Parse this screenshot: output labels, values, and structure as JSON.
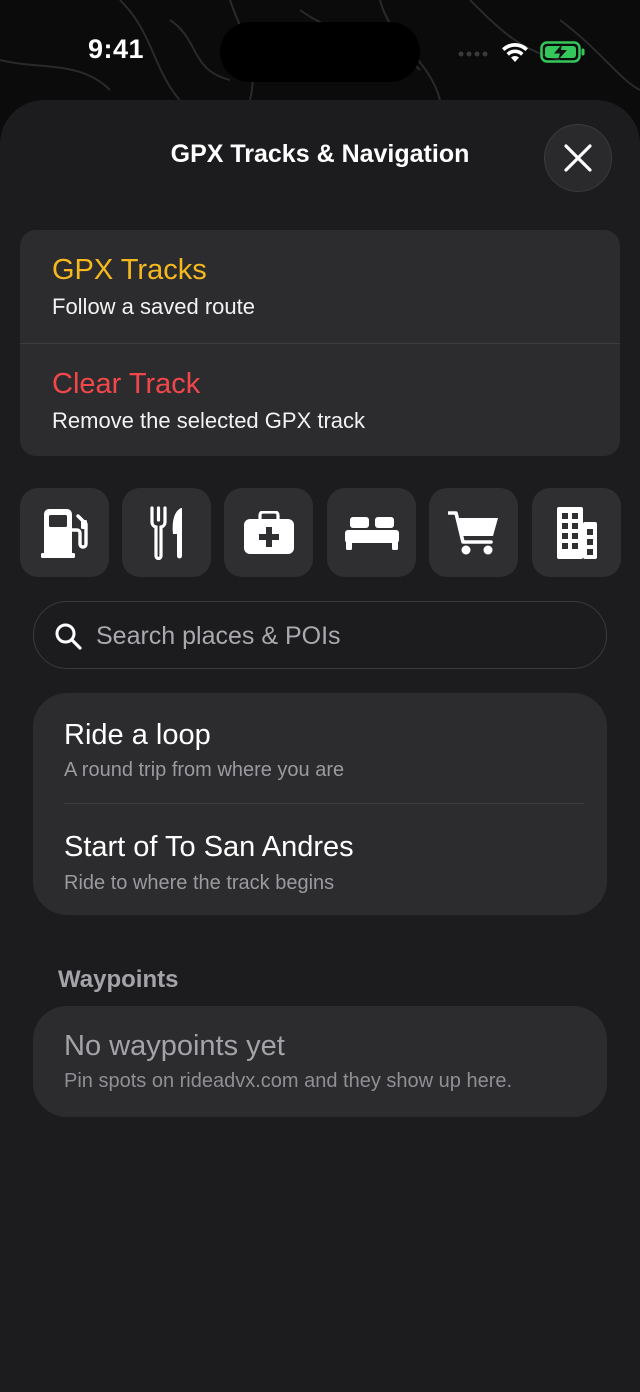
{
  "status_bar": {
    "time": "9:41",
    "icons": [
      "wifi-icon",
      "battery-charging-icon"
    ],
    "battery_color": "#34c759"
  },
  "sheet": {
    "title": "GPX Tracks & Navigation",
    "close_icon": "close-icon"
  },
  "tracks": {
    "items": [
      {
        "title": "GPX Tracks",
        "subtitle": "Follow a saved route",
        "color": "#f5b81f"
      },
      {
        "title": "Clear Track",
        "subtitle": "Remove the selected GPX track",
        "color": "#f2474a"
      }
    ]
  },
  "poi_categories": [
    {
      "icon": "fuel-pump-icon"
    },
    {
      "icon": "fork-knife-icon"
    },
    {
      "icon": "medical-kit-icon"
    },
    {
      "icon": "bed-icon"
    },
    {
      "icon": "shopping-cart-icon"
    },
    {
      "icon": "building-icon"
    }
  ],
  "search": {
    "placeholder": "Search places & POIs",
    "icon": "search-icon"
  },
  "navigation": {
    "items": [
      {
        "title": "Ride a loop",
        "subtitle": "A round trip from where you are"
      },
      {
        "title": "Start of To San Andres",
        "subtitle": "Ride to where the track begins"
      }
    ]
  },
  "waypoints": {
    "header": "Waypoints",
    "empty_title": "No waypoints yet",
    "empty_subtitle": "Pin spots on rideadvx.com and they show up here."
  }
}
